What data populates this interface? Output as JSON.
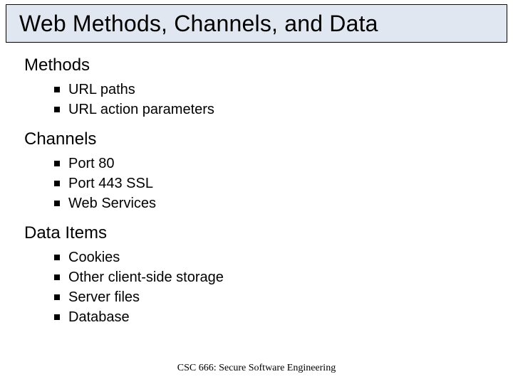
{
  "title": "Web Methods, Channels, and Data",
  "sections": [
    {
      "heading": "Methods",
      "items": [
        "URL paths",
        "URL action parameters"
      ]
    },
    {
      "heading": "Channels",
      "items": [
        "Port 80",
        "Port 443 SSL",
        "Web Services"
      ]
    },
    {
      "heading": "Data Items",
      "items": [
        "Cookies",
        "Other client-side storage",
        "Server files",
        "Database"
      ]
    }
  ],
  "footer": "CSC 666: Secure Software Engineering"
}
